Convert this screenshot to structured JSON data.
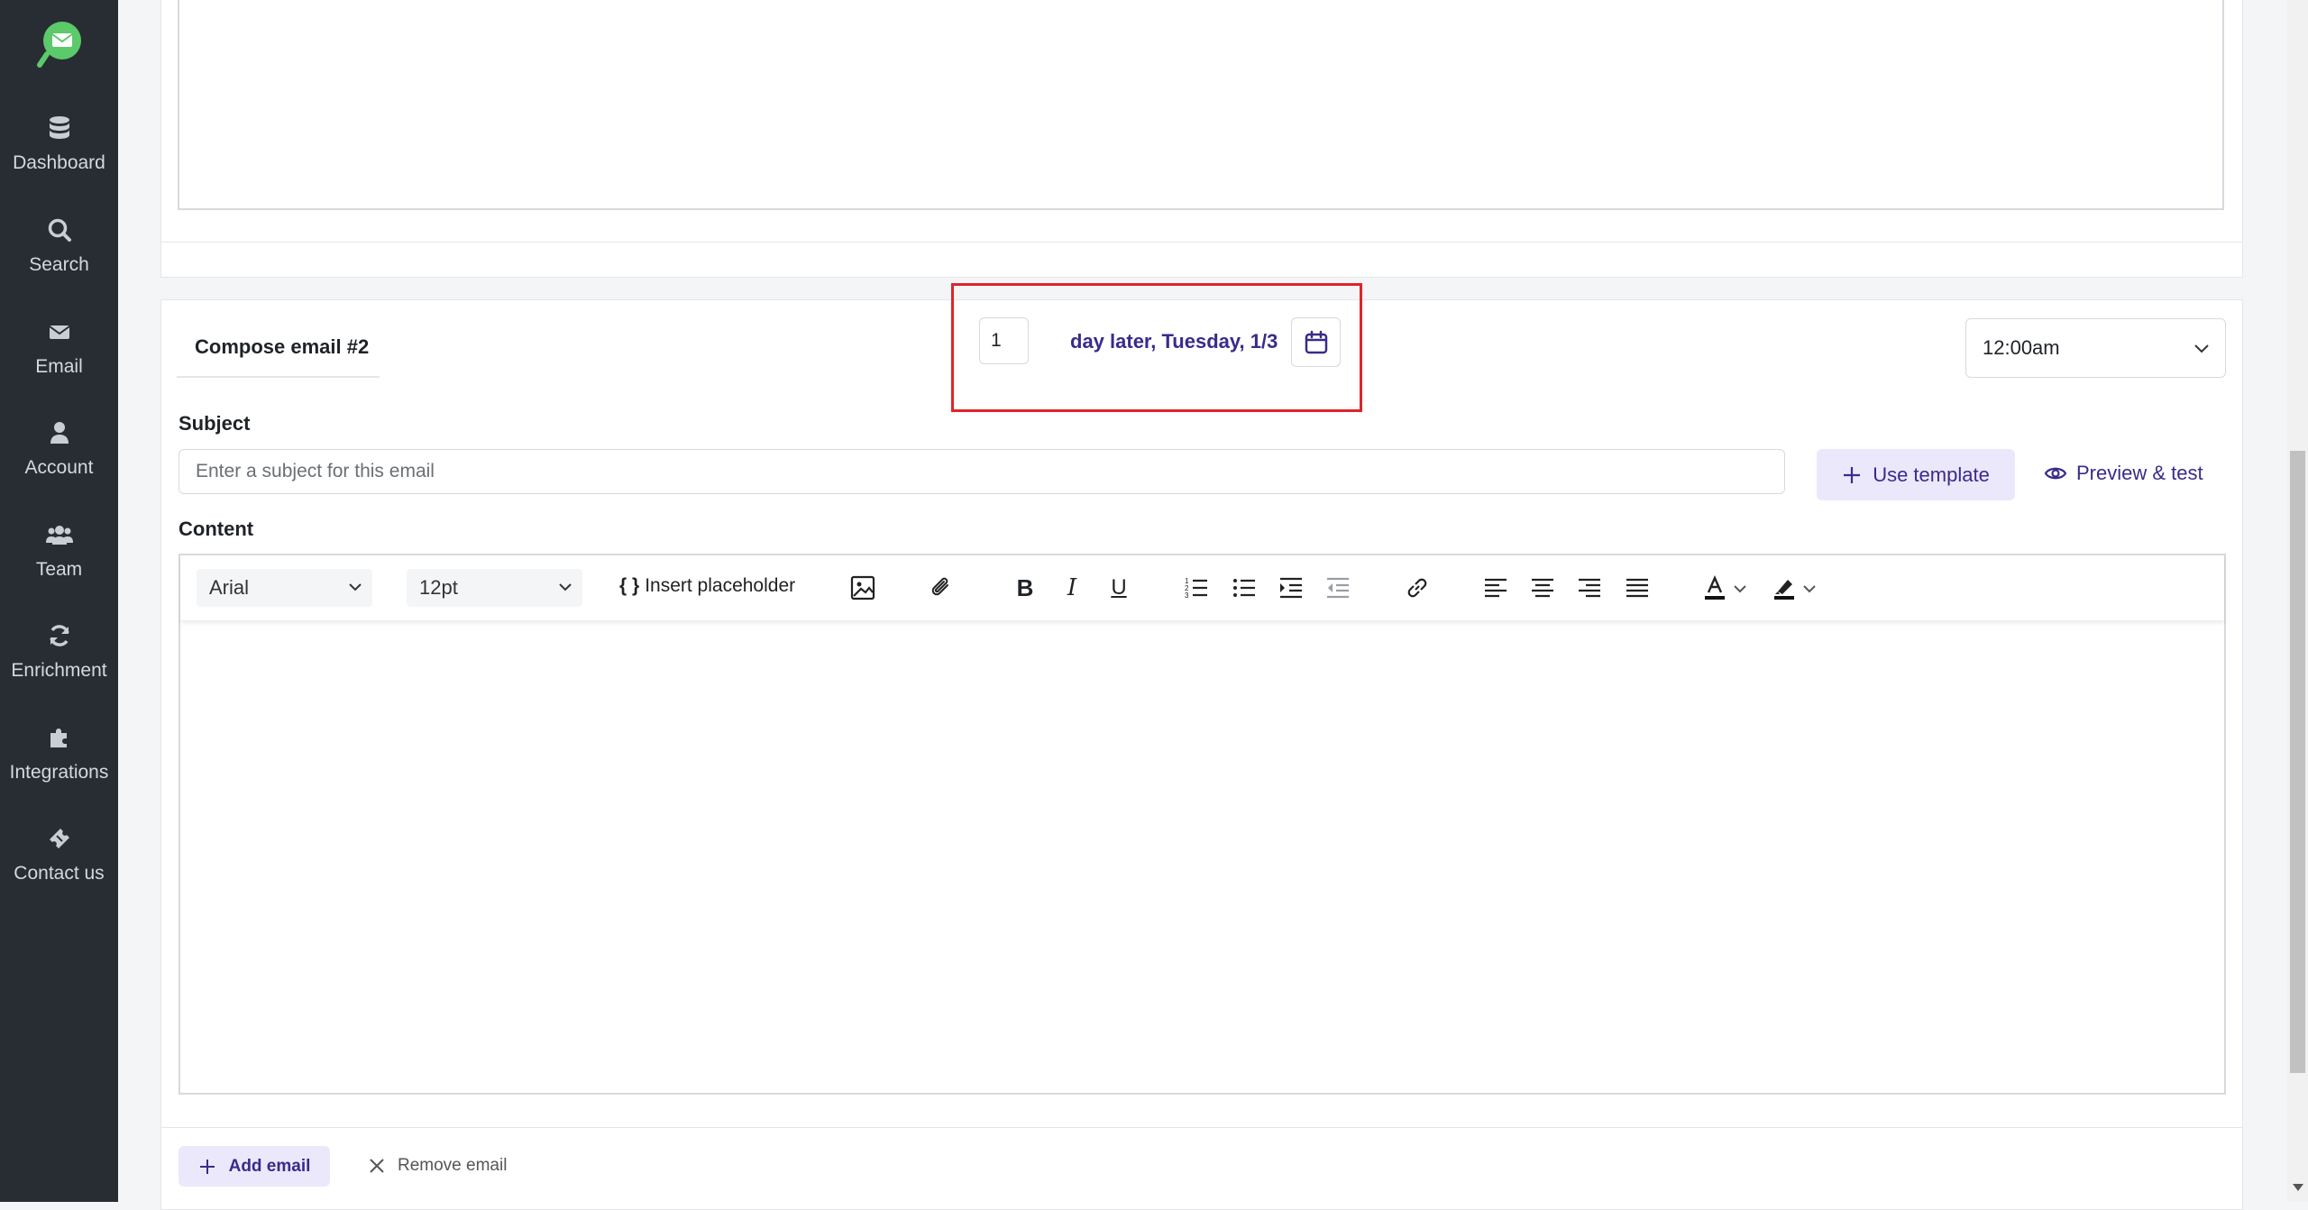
{
  "sidebar": {
    "items": [
      {
        "label": "Dashboard",
        "icon": "database-icon"
      },
      {
        "label": "Search",
        "icon": "search-icon"
      },
      {
        "label": "Email",
        "icon": "envelope-icon"
      },
      {
        "label": "Account",
        "icon": "user-icon"
      },
      {
        "label": "Team",
        "icon": "team-icon"
      },
      {
        "label": "Enrichment",
        "icon": "refresh-icon"
      },
      {
        "label": "Integrations",
        "icon": "puzzle-icon"
      },
      {
        "label": "Contact us",
        "icon": "ticket-icon"
      }
    ]
  },
  "compose": {
    "tab_title": "Compose email #2",
    "delay_days": "1",
    "delay_text": "day later, Tuesday, 1/3",
    "time_value": "12:00am",
    "subject_label": "Subject",
    "subject_placeholder": "Enter a subject for this email",
    "use_template_label": "Use template",
    "preview_label": "Preview & test",
    "content_label": "Content",
    "font_value": "Arial",
    "size_value": "12pt",
    "insert_placeholder_label": "Insert placeholder",
    "add_email_label": "Add email",
    "remove_email_label": "Remove email"
  },
  "colors": {
    "sidebar_bg": "#272d33",
    "accent": "#3b2a8a",
    "accent_soft": "#ece8fb",
    "highlight": "#e0242a",
    "logo_green": "#5cc96b"
  }
}
